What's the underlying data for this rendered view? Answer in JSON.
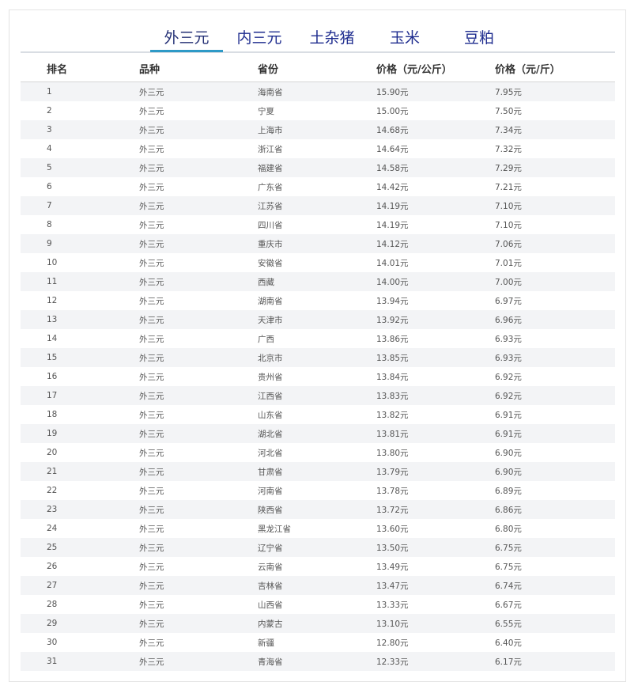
{
  "tabs": [
    {
      "label": "外三元",
      "active": true
    },
    {
      "label": "内三元",
      "active": false
    },
    {
      "label": "土杂猪",
      "active": false
    },
    {
      "label": "玉米",
      "active": false
    },
    {
      "label": "豆粕",
      "active": false
    }
  ],
  "table": {
    "headers": [
      "排名",
      "品种",
      "省份",
      "价格（元/公斤）",
      "价格（元/斤）"
    ],
    "rows": [
      [
        "1",
        "外三元",
        "海南省",
        "15.90元",
        "7.95元"
      ],
      [
        "2",
        "外三元",
        "宁夏",
        "15.00元",
        "7.50元"
      ],
      [
        "3",
        "外三元",
        "上海市",
        "14.68元",
        "7.34元"
      ],
      [
        "4",
        "外三元",
        "浙江省",
        "14.64元",
        "7.32元"
      ],
      [
        "5",
        "外三元",
        "福建省",
        "14.58元",
        "7.29元"
      ],
      [
        "6",
        "外三元",
        "广东省",
        "14.42元",
        "7.21元"
      ],
      [
        "7",
        "外三元",
        "江苏省",
        "14.19元",
        "7.10元"
      ],
      [
        "8",
        "外三元",
        "四川省",
        "14.19元",
        "7.10元"
      ],
      [
        "9",
        "外三元",
        "重庆市",
        "14.12元",
        "7.06元"
      ],
      [
        "10",
        "外三元",
        "安徽省",
        "14.01元",
        "7.01元"
      ],
      [
        "11",
        "外三元",
        "西藏",
        "14.00元",
        "7.00元"
      ],
      [
        "12",
        "外三元",
        "湖南省",
        "13.94元",
        "6.97元"
      ],
      [
        "13",
        "外三元",
        "天津市",
        "13.92元",
        "6.96元"
      ],
      [
        "14",
        "外三元",
        "广西",
        "13.86元",
        "6.93元"
      ],
      [
        "15",
        "外三元",
        "北京市",
        "13.85元",
        "6.93元"
      ],
      [
        "16",
        "外三元",
        "贵州省",
        "13.84元",
        "6.92元"
      ],
      [
        "17",
        "外三元",
        "江西省",
        "13.83元",
        "6.92元"
      ],
      [
        "18",
        "外三元",
        "山东省",
        "13.82元",
        "6.91元"
      ],
      [
        "19",
        "外三元",
        "湖北省",
        "13.81元",
        "6.91元"
      ],
      [
        "20",
        "外三元",
        "河北省",
        "13.80元",
        "6.90元"
      ],
      [
        "21",
        "外三元",
        "甘肃省",
        "13.79元",
        "6.90元"
      ],
      [
        "22",
        "外三元",
        "河南省",
        "13.78元",
        "6.89元"
      ],
      [
        "23",
        "外三元",
        "陕西省",
        "13.72元",
        "6.86元"
      ],
      [
        "24",
        "外三元",
        "黑龙江省",
        "13.60元",
        "6.80元"
      ],
      [
        "25",
        "外三元",
        "辽宁省",
        "13.50元",
        "6.75元"
      ],
      [
        "26",
        "外三元",
        "云南省",
        "13.49元",
        "6.75元"
      ],
      [
        "27",
        "外三元",
        "吉林省",
        "13.47元",
        "6.74元"
      ],
      [
        "28",
        "外三元",
        "山西省",
        "13.33元",
        "6.67元"
      ],
      [
        "29",
        "外三元",
        "内蒙古",
        "13.10元",
        "6.55元"
      ],
      [
        "30",
        "外三元",
        "新疆",
        "12.80元",
        "6.40元"
      ],
      [
        "31",
        "外三元",
        "青海省",
        "12.33元",
        "6.17元"
      ]
    ]
  },
  "colors": {
    "tab_text": "#1f2d8f",
    "tab_indicator": "#2e9ac7",
    "row_stripe": "#f3f4f6"
  }
}
